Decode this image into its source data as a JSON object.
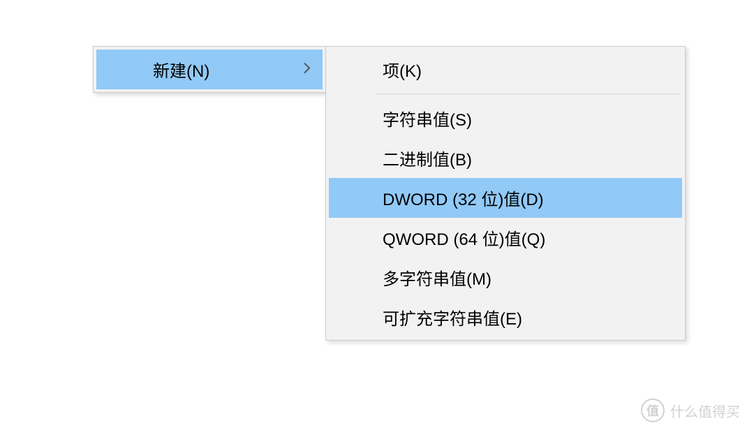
{
  "mainMenu": {
    "newItem": "新建(N)"
  },
  "submenu": {
    "key": "项(K)",
    "stringValue": "字符串值(S)",
    "binaryValue": "二进制值(B)",
    "dwordValue": "DWORD (32 位)值(D)",
    "qwordValue": "QWORD (64 位)值(Q)",
    "multiStringValue": "多字符串值(M)",
    "expandableStringValue": "可扩充字符串值(E)"
  },
  "watermark": {
    "icon": "值",
    "text": "什么值得买"
  }
}
